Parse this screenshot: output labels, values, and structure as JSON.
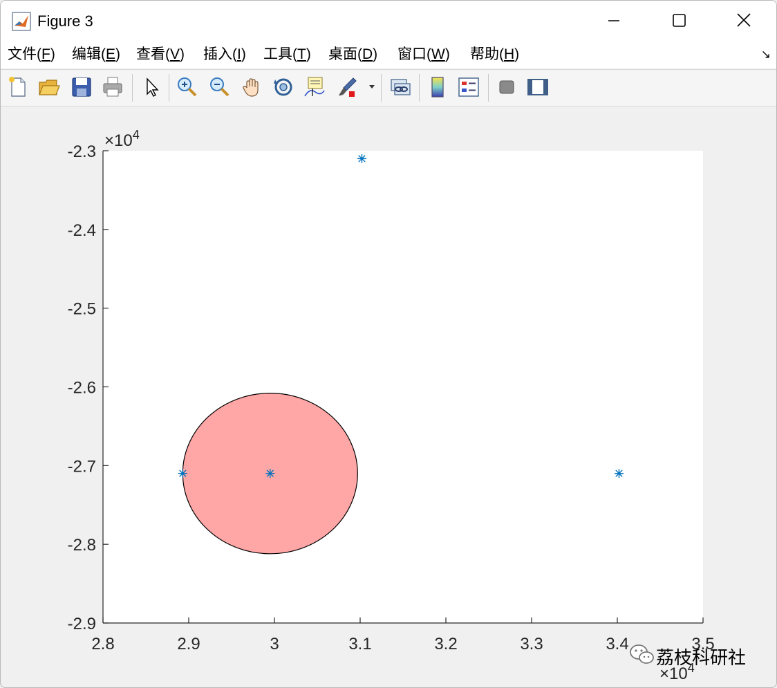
{
  "window": {
    "title": "Figure 3",
    "controls": [
      "minimize-icon",
      "maximize-icon",
      "close-icon"
    ]
  },
  "menu": {
    "items": [
      {
        "label": "文件(",
        "key": "F",
        "end": ")"
      },
      {
        "label": "编辑(",
        "key": "E",
        "end": ")"
      },
      {
        "label": "查看(",
        "key": "V",
        "end": ")"
      },
      {
        "label": "插入(",
        "key": "I",
        "end": ")"
      },
      {
        "label": "工具(",
        "key": "T",
        "end": ")"
      },
      {
        "label": "桌面(",
        "key": "D",
        "end": ")"
      },
      {
        "label": "窗口(",
        "key": "W",
        "end": ")"
      },
      {
        "label": "帮助(",
        "key": "H",
        "end": ")"
      }
    ],
    "overflow_glyph": "↘"
  },
  "toolbar": {
    "icons": [
      "new-figure-icon",
      "open-file-icon",
      "save-icon",
      "print-icon",
      "select-arrow-icon",
      "zoom-in-icon",
      "zoom-out-icon",
      "pan-hand-icon",
      "rotate-3d-icon",
      "data-cursor-icon",
      "brush-icon",
      "dropdown-arrow-icon",
      "link-plot-icon",
      "colorbar-icon",
      "legend-icon",
      "hide-plot-tools-icon",
      "show-plot-tools-icon"
    ]
  },
  "chart_data": {
    "type": "scatter",
    "title": "",
    "xlabel": "",
    "ylabel": "",
    "xlim": [
      28000,
      35000
    ],
    "ylim": [
      -29000,
      -23000
    ],
    "x_ticks": [
      "2.8",
      "2.9",
      "3",
      "3.1",
      "3.2",
      "3.3",
      "3.4",
      "3.5"
    ],
    "y_ticks": [
      "-2.3",
      "-2.4",
      "-2.5",
      "-2.6",
      "-2.7",
      "-2.8",
      "-2.9"
    ],
    "x_exponent_label": "×10",
    "x_exponent_power": "4",
    "y_exponent_label": "×10",
    "y_exponent_power": "4",
    "grid": false,
    "marker": "*",
    "marker_color": "#0072bd",
    "points": [
      {
        "x": 31020,
        "y": -23100
      },
      {
        "x": 28930,
        "y": -27100
      },
      {
        "x": 29950,
        "y": -27100
      },
      {
        "x": 34020,
        "y": -27100
      }
    ],
    "circle": {
      "center": {
        "x": 29950,
        "y": -27100
      },
      "radius": 1020,
      "fill": "#ffa6a6",
      "edge": "#000000"
    }
  },
  "watermark": {
    "text": "荔枝科研社",
    "icon": "wechat-icon"
  }
}
